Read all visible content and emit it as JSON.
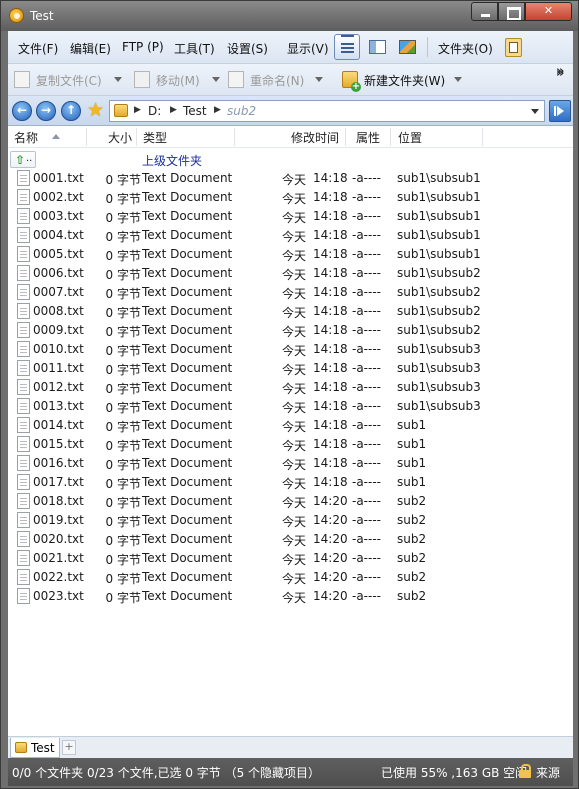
{
  "window": {
    "title": "Test"
  },
  "menu": [
    "文件(F)",
    "编辑(E)",
    "FTP (P)",
    "工具(T)",
    "设置(S)",
    "显示(V)",
    "文件夹(O)"
  ],
  "toolbar": {
    "copy": "复制文件(C)",
    "move": "移动(M)",
    "rename": "重命名(N)",
    "new_folder": "新建文件夹(W)"
  },
  "address": {
    "drive": "D:",
    "folder": "Test",
    "current": "sub2"
  },
  "columns": {
    "name": "名称",
    "size": "大小",
    "type": "类型",
    "modified": "修改时间",
    "attr": "属性",
    "location": "位置"
  },
  "parent": {
    "icon_label": "..",
    "label": "上级文件夹"
  },
  "files": [
    {
      "name": "0001.txt",
      "size": "0 字节",
      "type": "Text Document",
      "date": "今天",
      "time": "14:18",
      "attr": "-a----",
      "location": "sub1\\subsub1"
    },
    {
      "name": "0002.txt",
      "size": "0 字节",
      "type": "Text Document",
      "date": "今天",
      "time": "14:18",
      "attr": "-a----",
      "location": "sub1\\subsub1"
    },
    {
      "name": "0003.txt",
      "size": "0 字节",
      "type": "Text Document",
      "date": "今天",
      "time": "14:18",
      "attr": "-a----",
      "location": "sub1\\subsub1"
    },
    {
      "name": "0004.txt",
      "size": "0 字节",
      "type": "Text Document",
      "date": "今天",
      "time": "14:18",
      "attr": "-a----",
      "location": "sub1\\subsub1"
    },
    {
      "name": "0005.txt",
      "size": "0 字节",
      "type": "Text Document",
      "date": "今天",
      "time": "14:18",
      "attr": "-a----",
      "location": "sub1\\subsub1"
    },
    {
      "name": "0006.txt",
      "size": "0 字节",
      "type": "Text Document",
      "date": "今天",
      "time": "14:18",
      "attr": "-a----",
      "location": "sub1\\subsub2"
    },
    {
      "name": "0007.txt",
      "size": "0 字节",
      "type": "Text Document",
      "date": "今天",
      "time": "14:18",
      "attr": "-a----",
      "location": "sub1\\subsub2"
    },
    {
      "name": "0008.txt",
      "size": "0 字节",
      "type": "Text Document",
      "date": "今天",
      "time": "14:18",
      "attr": "-a----",
      "location": "sub1\\subsub2"
    },
    {
      "name": "0009.txt",
      "size": "0 字节",
      "type": "Text Document",
      "date": "今天",
      "time": "14:18",
      "attr": "-a----",
      "location": "sub1\\subsub2"
    },
    {
      "name": "0010.txt",
      "size": "0 字节",
      "type": "Text Document",
      "date": "今天",
      "time": "14:18",
      "attr": "-a----",
      "location": "sub1\\subsub3"
    },
    {
      "name": "0011.txt",
      "size": "0 字节",
      "type": "Text Document",
      "date": "今天",
      "time": "14:18",
      "attr": "-a----",
      "location": "sub1\\subsub3"
    },
    {
      "name": "0012.txt",
      "size": "0 字节",
      "type": "Text Document",
      "date": "今天",
      "time": "14:18",
      "attr": "-a----",
      "location": "sub1\\subsub3"
    },
    {
      "name": "0013.txt",
      "size": "0 字节",
      "type": "Text Document",
      "date": "今天",
      "time": "14:18",
      "attr": "-a----",
      "location": "sub1\\subsub3"
    },
    {
      "name": "0014.txt",
      "size": "0 字节",
      "type": "Text Document",
      "date": "今天",
      "time": "14:18",
      "attr": "-a----",
      "location": "sub1"
    },
    {
      "name": "0015.txt",
      "size": "0 字节",
      "type": "Text Document",
      "date": "今天",
      "time": "14:18",
      "attr": "-a----",
      "location": "sub1"
    },
    {
      "name": "0016.txt",
      "size": "0 字节",
      "type": "Text Document",
      "date": "今天",
      "time": "14:18",
      "attr": "-a----",
      "location": "sub1"
    },
    {
      "name": "0017.txt",
      "size": "0 字节",
      "type": "Text Document",
      "date": "今天",
      "time": "14:18",
      "attr": "-a----",
      "location": "sub1"
    },
    {
      "name": "0018.txt",
      "size": "0 字节",
      "type": "Text Document",
      "date": "今天",
      "time": "14:20",
      "attr": "-a----",
      "location": "sub2"
    },
    {
      "name": "0019.txt",
      "size": "0 字节",
      "type": "Text Document",
      "date": "今天",
      "time": "14:20",
      "attr": "-a----",
      "location": "sub2"
    },
    {
      "name": "0020.txt",
      "size": "0 字节",
      "type": "Text Document",
      "date": "今天",
      "time": "14:20",
      "attr": "-a----",
      "location": "sub2"
    },
    {
      "name": "0021.txt",
      "size": "0 字节",
      "type": "Text Document",
      "date": "今天",
      "time": "14:20",
      "attr": "-a----",
      "location": "sub2"
    },
    {
      "name": "0022.txt",
      "size": "0 字节",
      "type": "Text Document",
      "date": "今天",
      "time": "14:20",
      "attr": "-a----",
      "location": "sub2"
    },
    {
      "name": "0023.txt",
      "size": "0 字节",
      "type": "Text Document",
      "date": "今天",
      "time": "14:20",
      "attr": "-a----",
      "location": "sub2"
    }
  ],
  "tab": {
    "label": "Test",
    "add_label": "+"
  },
  "status": {
    "left": "0/0 个文件夹 0/23 个文件,已选 0 字节 （5 个隐藏项目）",
    "right": "已使用 55% ,163 GB 空闲",
    "source": "来源"
  },
  "colors": {
    "parent_link": "#1d2f9e",
    "accent": "#2361b8",
    "status_bar": "#555555"
  }
}
